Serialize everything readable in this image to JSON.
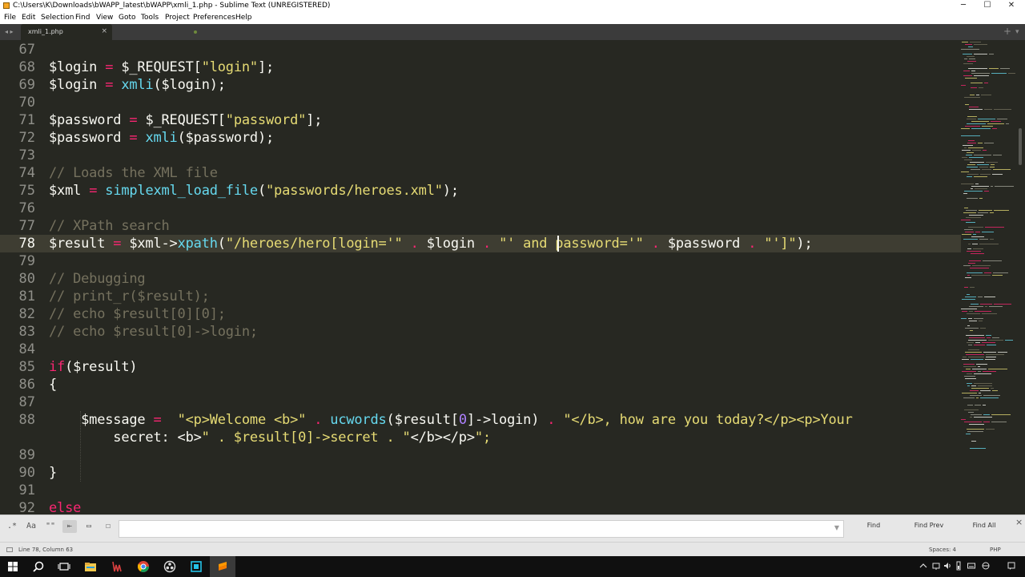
{
  "window": {
    "title": "C:\\Users\\K\\Downloads\\bWAPP_latest\\bWAPP\\xmli_1.php - Sublime Text (UNREGISTERED)",
    "controls": {
      "minimize": "─",
      "maximize": "☐",
      "close": "✕"
    }
  },
  "menu": [
    "File",
    "Edit",
    "Selection",
    "Find",
    "View",
    "Goto",
    "Tools",
    "Project",
    "Preferences",
    "Help"
  ],
  "tabs": {
    "active_tab": "xmli_1.php",
    "close_glyph": "×",
    "nav_glyph": "◂ ▸",
    "new_tab_glyph": "+",
    "tab_list_glyph": "▾"
  },
  "editor": {
    "line_numbers": [
      "67",
      "68",
      "69",
      "70",
      "71",
      "72",
      "73",
      "74",
      "75",
      "76",
      "77",
      "78",
      "79",
      "80",
      "81",
      "82",
      "83",
      "84",
      "85",
      "86",
      "87",
      "88",
      "",
      "89",
      "90",
      "91",
      "92"
    ],
    "current_line": "78",
    "theme_colors": {
      "background": "#272822",
      "keyword": "#f92672",
      "function": "#66d9ef",
      "string": "#e6db74",
      "comment": "#75715e",
      "number": "#ae81ff",
      "text": "#f8f8f2"
    },
    "lines": [
      "",
      "$login = $_REQUEST[\"login\"];",
      "$login = xmli($login);",
      "",
      "$password = $_REQUEST[\"password\"];",
      "$password = xmli($password);",
      "",
      "// Loads the XML file",
      "$xml = simplexml_load_file(\"passwords/heroes.xml\");",
      "",
      "// XPath search",
      "$result = $xml->xpath(\"/heroes/hero[login='\" . $login . \"' and password='\" . $password . \"']\");",
      "",
      "// Debugging",
      "// print_r($result);",
      "// echo $result[0][0];",
      "// echo $result[0]->login;",
      "",
      "if($result)",
      "{",
      "",
      "    $message =  \"<p>Welcome <b>\" . ucwords($result[0]->login) . \"</b>, how are you today?</p><p>Your",
      "        secret: <b>\" . $result[0]->secret . \"</b></p>\";",
      "",
      "}",
      "",
      "else"
    ]
  },
  "find_panel": {
    "options": [
      ".*",
      "Aa",
      "\"\"",
      "⇤",
      "▭",
      "☐"
    ],
    "input_value": "",
    "dropdown_glyph": "▼",
    "buttons": [
      "Find",
      "Find Prev",
      "Find All"
    ],
    "close_glyph": "×"
  },
  "status": {
    "position": "Line 78, Column 63",
    "indent": "Spaces: 4",
    "syntax": "PHP"
  },
  "taskbar": {
    "icons": [
      "windows-start-icon",
      "search-icon",
      "task-view-icon",
      "file-explorer-icon",
      "notepad-icon",
      "chrome-icon",
      "obs-icon",
      "files-icon",
      "sublime-text-icon"
    ],
    "tray": [
      "chevron-up-icon",
      "network-icon",
      "volume-icon",
      "battery-icon",
      "keyboard-icon",
      "language-icon",
      "notification-icon"
    ]
  }
}
